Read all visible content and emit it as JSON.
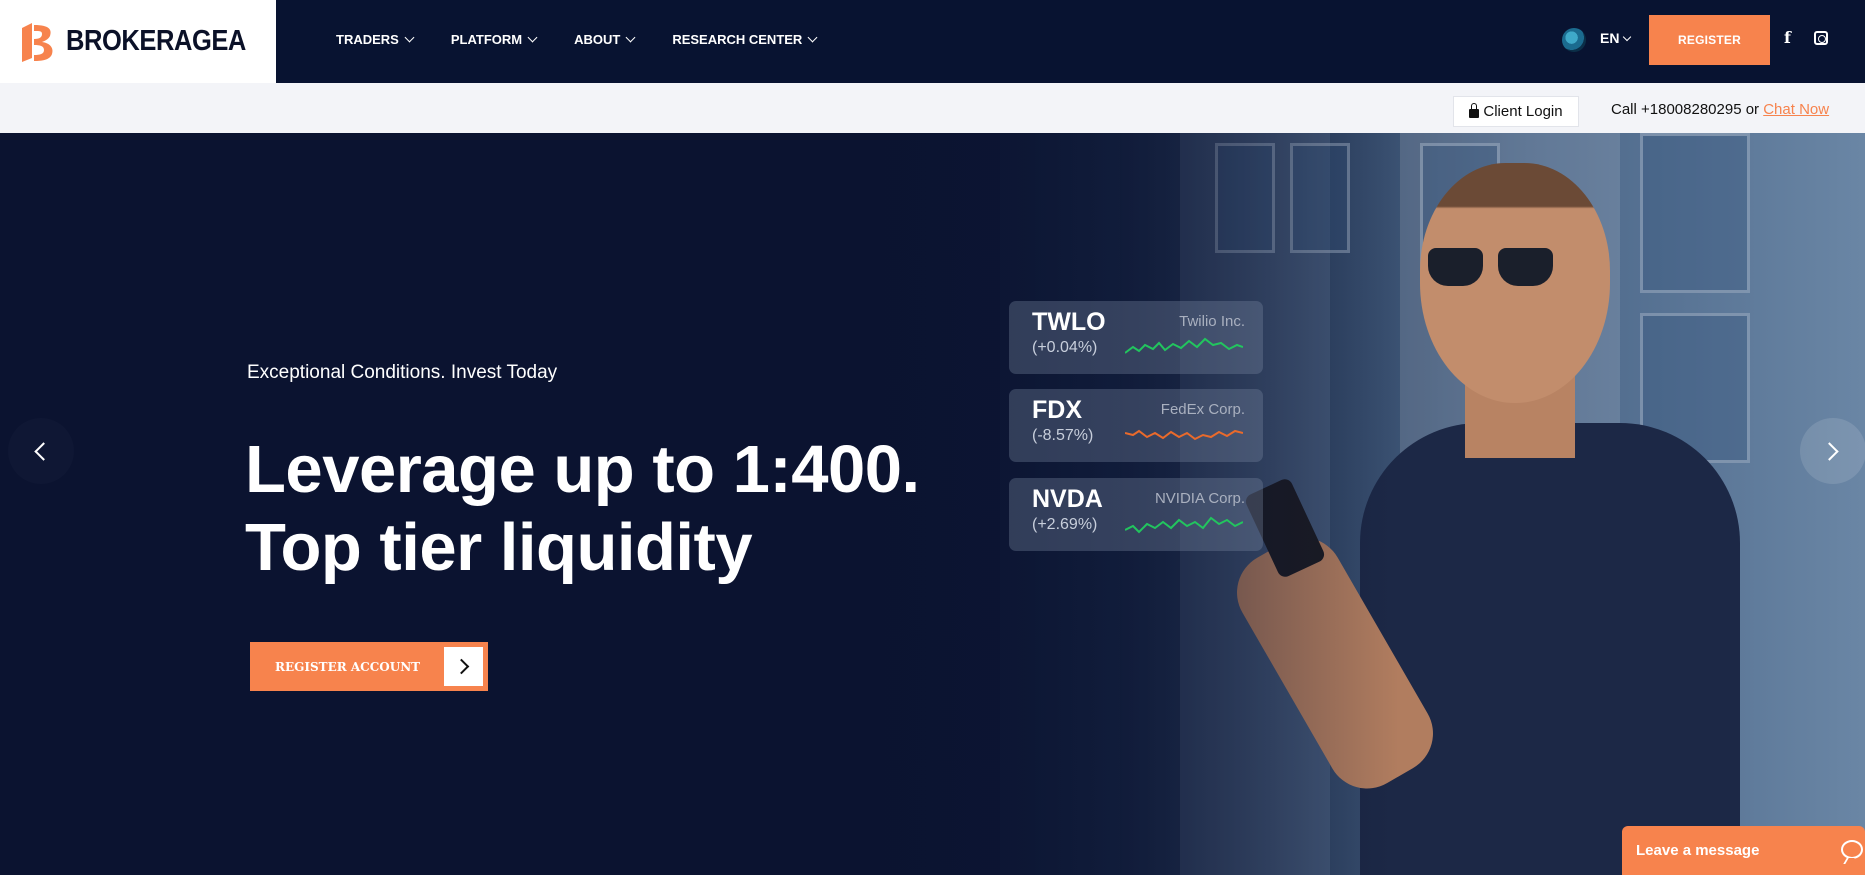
{
  "brand": {
    "name": "BROKERAGEA",
    "accent": "#f7834d",
    "navy": "#081331"
  },
  "nav": {
    "items": [
      {
        "label": "TRADERS"
      },
      {
        "label": "PLATFORM"
      },
      {
        "label": "ABOUT"
      },
      {
        "label": "RESEARCH CENTER"
      }
    ],
    "language": "EN",
    "register_label": "REGISTER",
    "icons": [
      "globe-icon",
      "facebook-icon",
      "instagram-icon"
    ]
  },
  "subbar": {
    "client_login_label": "Client Login",
    "call_text": "Call +18008280295 or ",
    "chat_link_label": "Chat Now"
  },
  "hero": {
    "subtitle": "Exceptional Conditions. Invest Today",
    "headline_line1": "Leverage up to 1:400.",
    "headline_line2": "Top tier liquidity",
    "cta_label": "REGISTER ACCOUNT",
    "tickers": [
      {
        "symbol": "TWLO",
        "change": "(+0.04%)",
        "company": "Twilio Inc.",
        "trend_color": "#22c55e"
      },
      {
        "symbol": "FDX",
        "change": "(-8.57%)",
        "company": "FedEx Corp.",
        "trend_color": "#ea6a2b"
      },
      {
        "symbol": "NVDA",
        "change": "(+2.69%)",
        "company": "NVIDIA Corp.",
        "trend_color": "#22c55e"
      }
    ]
  },
  "chat_widget": {
    "label": "Leave a message"
  }
}
